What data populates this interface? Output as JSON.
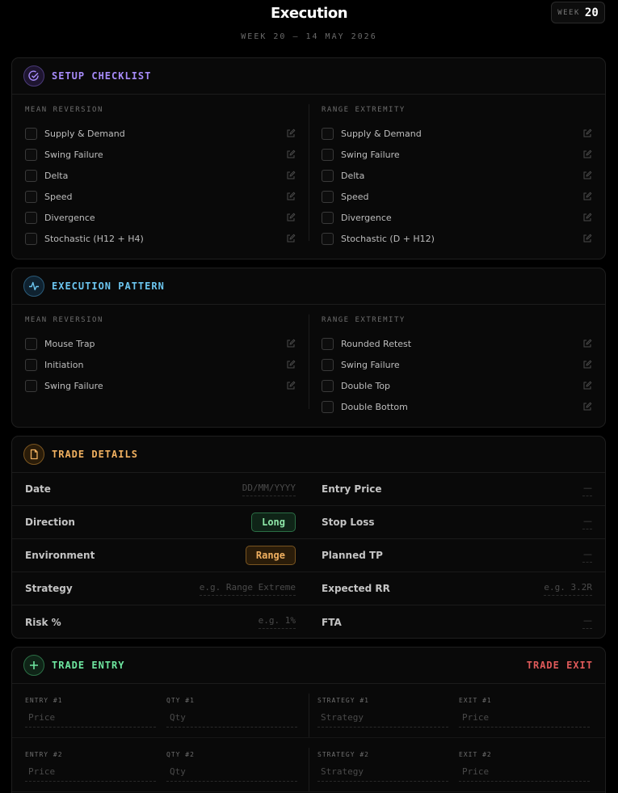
{
  "header": {
    "title": "Execution",
    "subtitle": "WEEK 20 — 14 MAY 2026",
    "week_label": "WEEK",
    "week_num": "20"
  },
  "setup_checklist": {
    "title": "SETUP CHECKLIST",
    "accent": "#a78bfa",
    "left": {
      "label": "MEAN REVERSION",
      "items": [
        "Supply & Demand",
        "Swing Failure",
        "Delta",
        "Speed",
        "Divergence",
        "Stochastic (H12 + H4)"
      ]
    },
    "right": {
      "label": "RANGE EXTREMITY",
      "items": [
        "Supply & Demand",
        "Swing Failure",
        "Delta",
        "Speed",
        "Divergence",
        "Stochastic (D + H12)"
      ]
    }
  },
  "execution_pattern": {
    "title": "EXECUTION PATTERN",
    "accent": "#6cc6f0",
    "left": {
      "label": "MEAN REVERSION",
      "items": [
        "Mouse Trap",
        "Initiation",
        "Swing Failure"
      ]
    },
    "right": {
      "label": "RANGE EXTREMITY",
      "items": [
        "Rounded Retest",
        "Swing Failure",
        "Double Top",
        "Double Bottom"
      ]
    }
  },
  "trade_details": {
    "title": "TRADE DETAILS",
    "accent": "#f0b060",
    "date_label": "Date",
    "date_placeholder": "DD/MM/YYYY",
    "entry_price_label": "Entry Price",
    "entry_price_value": "—",
    "direction_label": "Direction",
    "direction_value": "Long",
    "stop_loss_label": "Stop Loss",
    "stop_loss_value": "—",
    "environment_label": "Environment",
    "environment_value": "Range",
    "planned_tp_label": "Planned TP",
    "planned_tp_value": "—",
    "strategy_label": "Strategy",
    "strategy_placeholder": "e.g. Range Extreme",
    "expected_rr_label": "Expected RR",
    "expected_rr_placeholder": "e.g. 3.2R",
    "risk_label": "Risk %",
    "risk_placeholder": "e.g. 1%",
    "fta_label": "FTA",
    "fta_value": "—"
  },
  "trade_entry": {
    "title": "TRADE ENTRY",
    "exit_title": "TRADE EXIT",
    "accent": "#6ee7a0",
    "exit_accent": "#e05a5a",
    "rows": [
      {
        "entry_label": "ENTRY #1",
        "entry_ph": "Price",
        "qty_label": "QTY #1",
        "qty_ph": "Qty",
        "strategy_label": "STRATEGY #1",
        "strategy_ph": "Strategy",
        "exit_label": "EXIT #1",
        "exit_ph": "Price"
      },
      {
        "entry_label": "ENTRY #2",
        "entry_ph": "Price",
        "qty_label": "QTY #2",
        "qty_ph": "Qty",
        "strategy_label": "STRATEGY #2",
        "strategy_ph": "Strategy",
        "exit_label": "EXIT #2",
        "exit_ph": "Price"
      }
    ]
  }
}
